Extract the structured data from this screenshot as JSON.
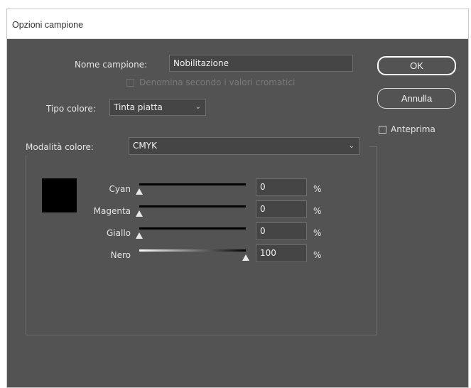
{
  "window": {
    "title": "Opzioni campione"
  },
  "swatch_name": {
    "label": "Nome campione:",
    "value": "Nobilitazione"
  },
  "name_by_color": {
    "label": "Denomina secondo i valori cromatici",
    "checked": false,
    "disabled": true
  },
  "color_type": {
    "label": "Tipo colore:",
    "value": "Tinta piatta"
  },
  "color_mode": {
    "label": "Modalità colore:",
    "value": "CMYK"
  },
  "swatch_color": "#000000",
  "channels": [
    {
      "label": "Cyan",
      "value": "0",
      "unit": "%",
      "level": 0
    },
    {
      "label": "Magenta",
      "value": "0",
      "unit": "%",
      "level": 0
    },
    {
      "label": "Giallo",
      "value": "0",
      "unit": "%",
      "level": 0
    },
    {
      "label": "Nero",
      "value": "100",
      "unit": "%",
      "level": 100
    }
  ],
  "buttons": {
    "ok": "OK",
    "cancel": "Annulla"
  },
  "preview": {
    "label": "Anteprima",
    "checked": false
  }
}
